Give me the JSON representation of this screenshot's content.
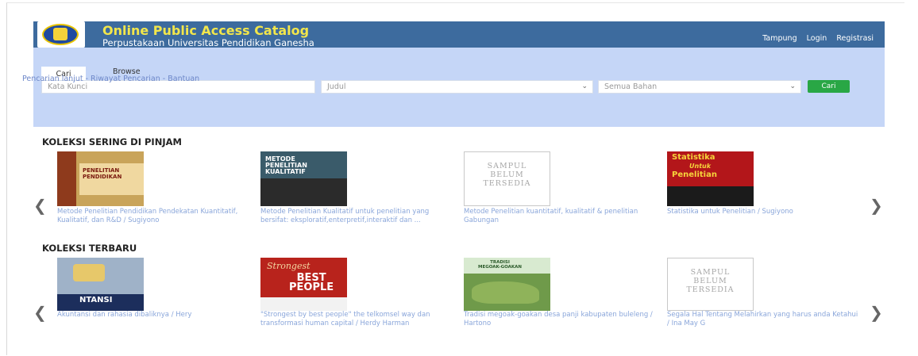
{
  "header": {
    "title": "Online Public Access Catalog",
    "subtitle": "Perpustakaan Universitas Pendidikan Ganesha",
    "links": [
      "Tampung",
      "Login",
      "Registrasi"
    ]
  },
  "search": {
    "tabs": [
      "Cari",
      "Browse"
    ],
    "keyword_placeholder": "Kata Kunci",
    "field_select": "Judul",
    "material_select": "Semua Bahan",
    "button": "Cari",
    "links": [
      "Pencarian lanjut",
      "Riwayat Pencarian",
      "Bantuan"
    ],
    "separator": " - "
  },
  "sections": [
    {
      "title": "KOLEKSI SERING DI PINJAM",
      "books": [
        {
          "caption": "Metode Penelitian Pendidikan Pendekatan Kuantitatif, Kualitatif, dan R&D / Sugiyono",
          "cover_text": [
            "PENELITIAN",
            "PENDIDIKAN"
          ]
        },
        {
          "caption": "Metode Penelitian Kualitatif untuk penelitian yang bersifat: eksploratif,enterpretif,interaktif dan ...",
          "cover_text": [
            "METODE",
            "PENELITIAN",
            "KUALITATIF"
          ]
        },
        {
          "caption": "Metode Penelitian kuantitatif, kualitatif & penelitian Gabungan",
          "cover_text": [
            "SAMPUL",
            "BELUM",
            "TERSEDIA"
          ]
        },
        {
          "caption": "Statistika untuk Penelitian / Sugiyono",
          "cover_text": [
            "Statistika",
            "Untuk",
            "Penelitian"
          ]
        }
      ]
    },
    {
      "title": "KOLEKSI TERBARU",
      "books": [
        {
          "caption": "Akuntansi dan rahasia dibaliknya / Hery",
          "cover_text": [
            "NTANSI"
          ]
        },
        {
          "caption": "\"Strongest by best people\" the telkomsel way dan transformasi human capital / Herdy Harman",
          "cover_text": [
            "Strongest",
            "BEST",
            "PEOPLE"
          ]
        },
        {
          "caption": "Tradisi megoak-goakan desa panji kabupaten buleleng / Hartono",
          "cover_text": [
            "TRADISI",
            "MEGOAK-GOAKAN"
          ]
        },
        {
          "caption": "Segala Hal Tentang Melahirkan yang harus anda Ketahui / Ina May G",
          "cover_text": [
            "SAMPUL",
            "BELUM",
            "TERSEDIA"
          ]
        }
      ]
    }
  ],
  "nav": {
    "prev": "❮",
    "next": "❯"
  },
  "colors": {
    "header": "#3d6b9e",
    "title": "#f2e64b",
    "panel": "#c5d6f7",
    "button": "#29a745",
    "caption": "#8aa6da"
  }
}
